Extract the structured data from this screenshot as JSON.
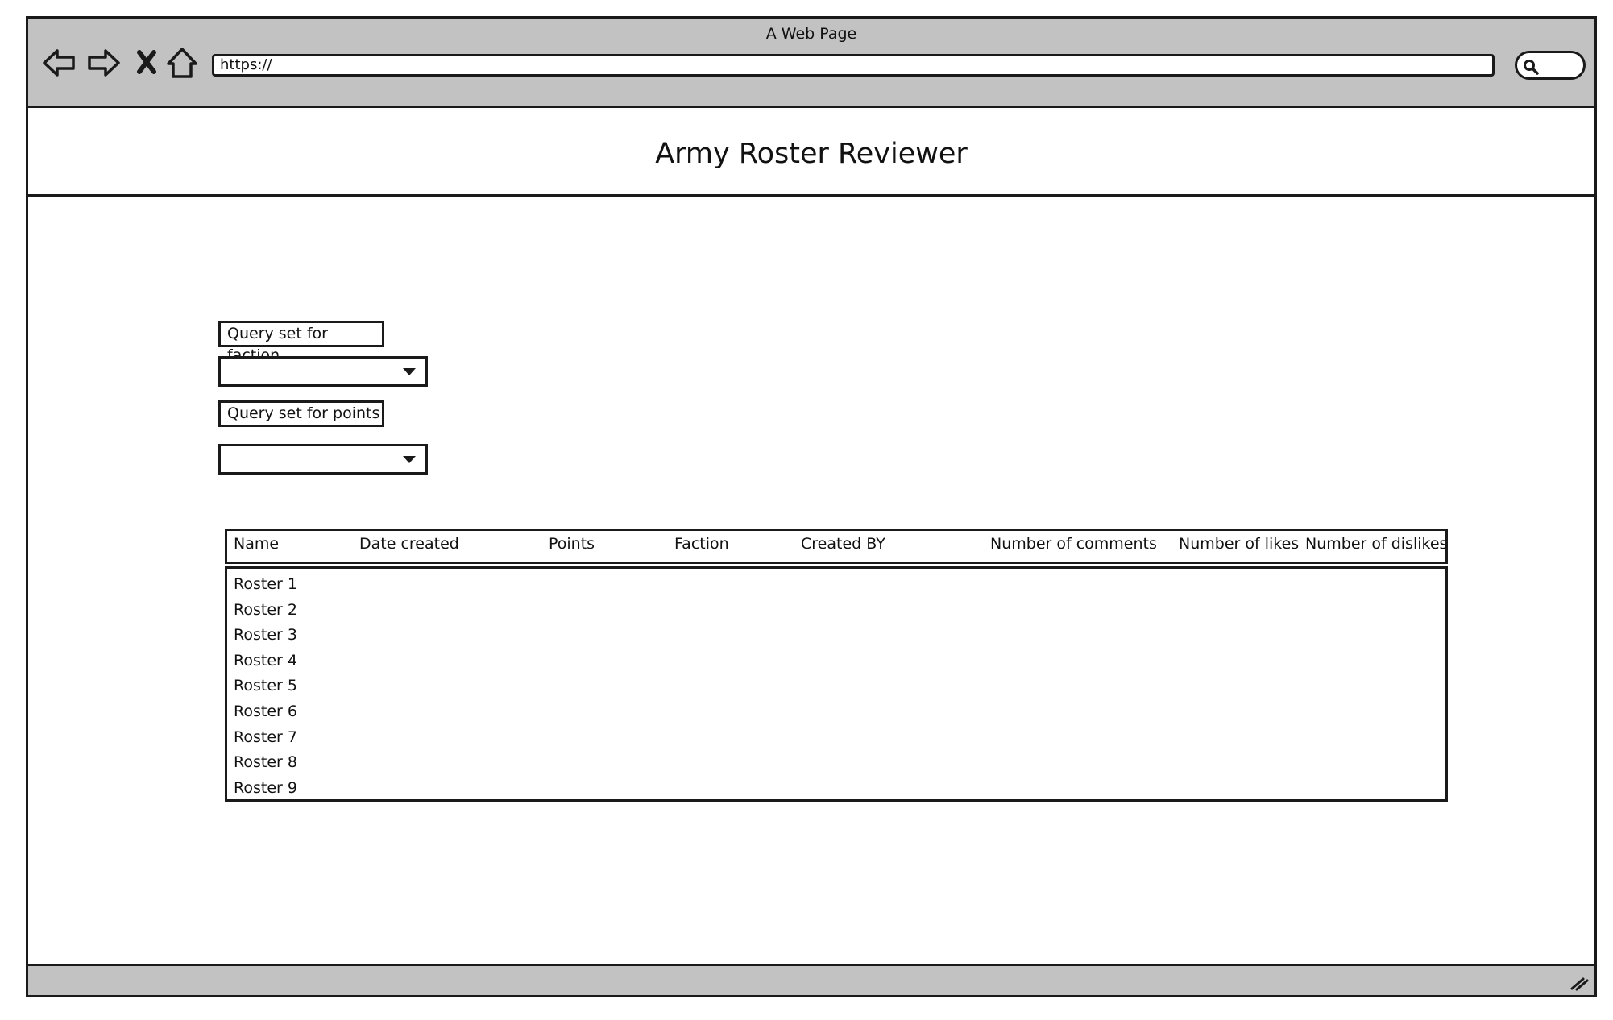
{
  "window": {
    "title": "A Web Page",
    "url": "https://"
  },
  "icons": {
    "back": "arrow-left-icon",
    "forward": "arrow-right-icon",
    "stop": "close-icon",
    "home": "home-icon",
    "search": "search-icon",
    "resize": "resize-grip-icon"
  },
  "page": {
    "title": "Army Roster Reviewer"
  },
  "filters": {
    "faction_label": "Query set for faction",
    "faction_value": "",
    "points_label": "Query set for points",
    "points_value": ""
  },
  "table": {
    "columns": [
      "Name",
      "Date created",
      "Points",
      "Faction",
      "Created BY",
      "Number of comments",
      "Number of likes",
      "Number of dislikes"
    ],
    "rows": [
      "Roster 1",
      "Roster 2",
      "Roster 3",
      "Roster 4",
      "Roster 5",
      "Roster 6",
      "Roster 7",
      "Roster 8",
      "Roster 9"
    ]
  },
  "colors": {
    "chrome": "#c2c2c2",
    "stroke": "#1a1a1a",
    "background": "#ffffff"
  }
}
